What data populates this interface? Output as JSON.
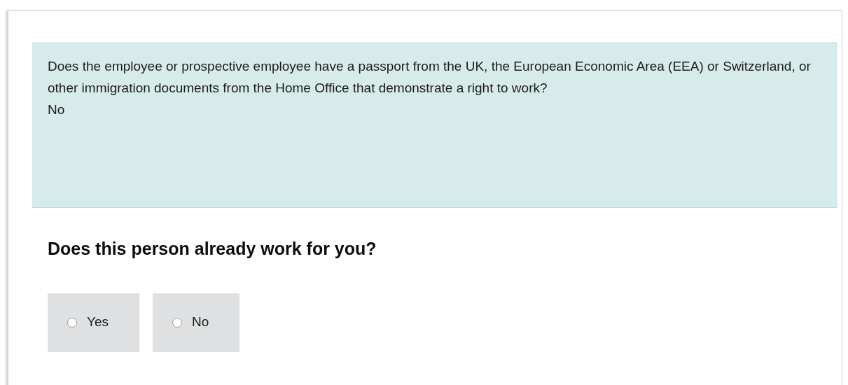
{
  "summary": {
    "question": "Does the employee or prospective employee have a passport from the UK, the European Economic Area (EEA) or Switzerland, or other immigration documents from the Home Office that demonstrate a right to work?",
    "answer": "No"
  },
  "question": {
    "heading": "Does this person already work for you?",
    "options": [
      {
        "label": "Yes",
        "selected": false
      },
      {
        "label": "No",
        "selected": false
      }
    ]
  }
}
